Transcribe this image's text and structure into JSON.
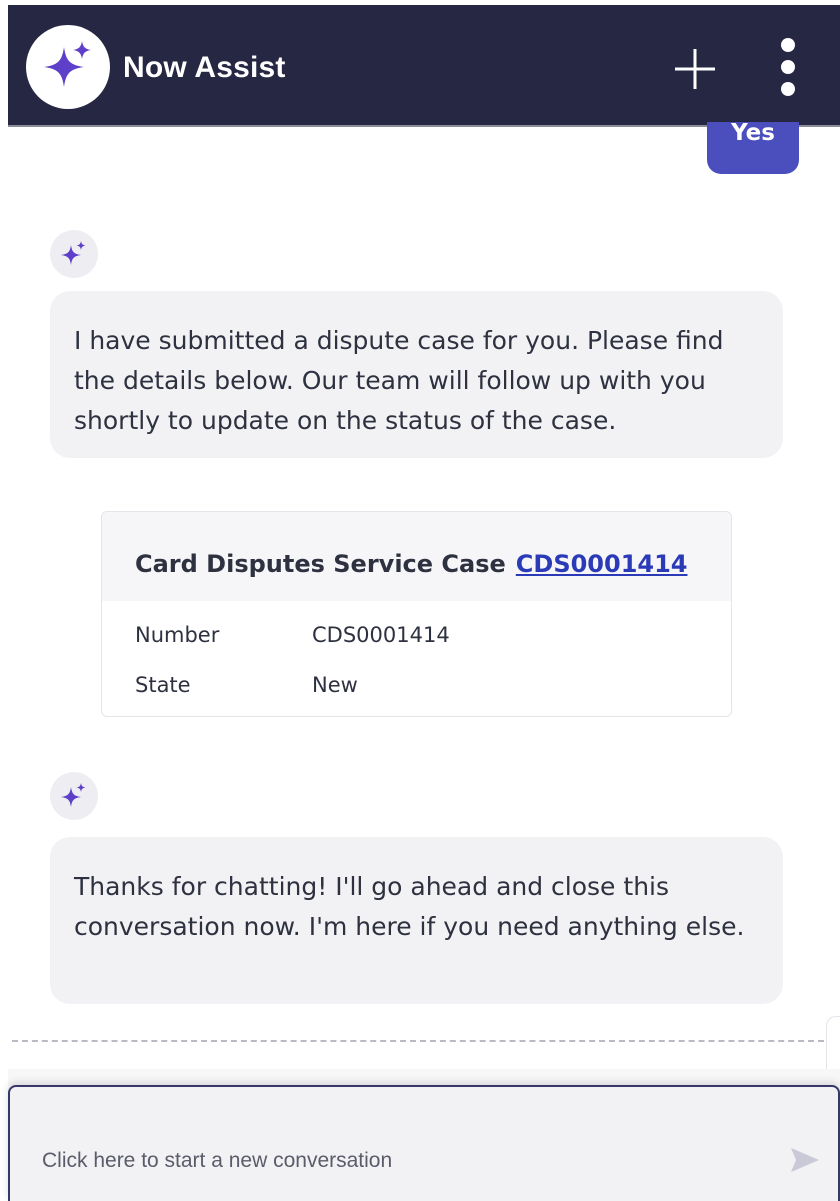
{
  "header": {
    "title": "Now Assist",
    "logo_icon": "sparkle-icon",
    "new_icon": "plus-icon",
    "more_icon": "more-vertical-icon"
  },
  "conversation": {
    "user_reply": "Yes",
    "bot_message_1": "I have submitted a dispute case for you. Please find the details below. Our team will follow up with you shortly to update on the status of the case.",
    "case_card": {
      "title": "Card Disputes Service Case",
      "link": "CDS0001414",
      "rows": [
        {
          "label": "Number",
          "value": "CDS0001414"
        },
        {
          "label": "State",
          "value": "New"
        }
      ]
    },
    "bot_message_2": "Thanks for chatting! I'll go ahead and close this conversation now. I'm here if you need anything else."
  },
  "composer": {
    "placeholder": "Click here to start a new conversation",
    "send_icon": "send-icon"
  },
  "colors": {
    "header_bg": "#262742",
    "accent": "#4b4fbd",
    "bubble_bg": "#f2f2f4",
    "link": "#2b3bb8"
  }
}
